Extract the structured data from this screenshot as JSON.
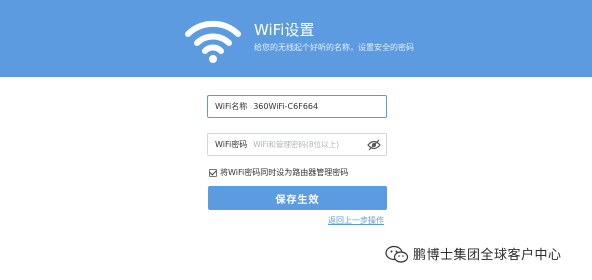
{
  "header": {
    "title": "WiFi设置",
    "subtitle": "给您的无线起个好听的名称，设置安全的密码",
    "background_color": "#5c9be0",
    "logo_icon": "wifi-icon"
  },
  "form": {
    "wifi_name": {
      "label": "WiFi名称",
      "value": "360WiFi-C6F664"
    },
    "wifi_password": {
      "label": "WiFi密码",
      "placeholder": "WiFi和管理密码(8位以上)",
      "toggle_icon": "eye-hidden-icon"
    },
    "same_password_checkbox": {
      "label": "将WiFi密码同时设为路由器管理密码",
      "checked": true
    },
    "save_button": "保存生效",
    "back_link": "返回上一步操作"
  },
  "watermark": {
    "icon": "wechat-icon",
    "text": "鹏博士集团全球客户中心"
  },
  "colors": {
    "accent": "#5c9be0",
    "text": "#333333",
    "placeholder": "#b0b5ba"
  }
}
